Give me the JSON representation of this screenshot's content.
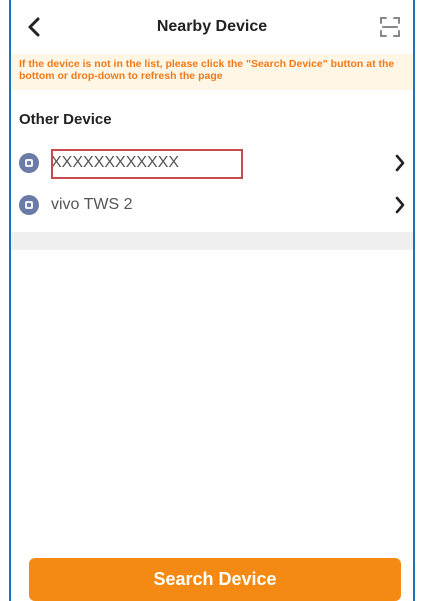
{
  "header": {
    "title": "Nearby Device"
  },
  "notice": {
    "text": "If the device is not in the list, please click the \"Search Device\" button at the bottom or drop-down to refresh the page"
  },
  "section": {
    "title": "Other Device"
  },
  "devices": [
    {
      "name": "XXXXXXXXXXXX"
    },
    {
      "name": "vivo TWS 2"
    }
  ],
  "footer": {
    "search_label": "Search Device"
  },
  "colors": {
    "accent": "#f48a13",
    "notice_text": "#f07a1a",
    "highlight": "#c84b4b",
    "icon": "#6b7ba7",
    "frame": "#1e73be"
  },
  "icons": {
    "back": "chevron-left-icon",
    "scan": "scan-icon",
    "device": "device-icon",
    "chevron": "chevron-right-icon"
  }
}
